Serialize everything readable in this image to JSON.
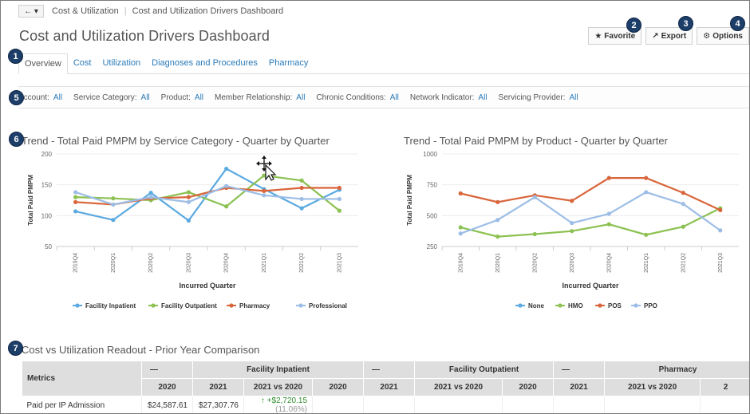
{
  "breadcrumb": {
    "nav": "← ▾",
    "items": [
      "Cost & Utilization",
      "Cost and Utilization Drivers Dashboard"
    ]
  },
  "title": "Cost and Utilization Drivers Dashboard",
  "actions": [
    {
      "label": "Favorite",
      "icon": "star-icon",
      "glyph": "★"
    },
    {
      "label": "Export",
      "icon": "export-icon",
      "glyph": "↗"
    },
    {
      "label": "Options",
      "icon": "gear-icon",
      "glyph": "⚙"
    }
  ],
  "badges": [
    "1",
    "2",
    "3",
    "4",
    "5",
    "6",
    "7"
  ],
  "tabs": [
    "Overview",
    "Cost",
    "Utilization",
    "Diagnoses and Procedures",
    "Pharmacy"
  ],
  "filters": [
    {
      "label": "Account:",
      "value": "All"
    },
    {
      "label": "Service Category:",
      "value": "All"
    },
    {
      "label": "Product:",
      "value": "All"
    },
    {
      "label": "Member Relationship:",
      "value": "All"
    },
    {
      "label": "Chronic Conditions:",
      "value": "All"
    },
    {
      "label": "Network Indicator:",
      "value": "All"
    },
    {
      "label": "Servicing Provider:",
      "value": "All"
    }
  ],
  "chart_data": [
    {
      "type": "line",
      "title": "Trend - Total Paid PMPM by Service Category - Quarter by Quarter",
      "xlabel": "Incurred Quarter",
      "ylabel": "Total Paid PMPM",
      "categories": [
        "2019Q4",
        "2020Q1",
        "2020Q2",
        "2020Q3",
        "2020Q4",
        "2021Q1",
        "2021Q2",
        "2021Q3"
      ],
      "ylim": [
        50,
        200
      ],
      "yticks": [
        50,
        100,
        150,
        200
      ],
      "grid": true,
      "legend": "bottom",
      "series": [
        {
          "name": "Facility Inpatient",
          "color": "#5aa9e0",
          "values": [
            107,
            93,
            137,
            92,
            176,
            143,
            112,
            142
          ]
        },
        {
          "name": "Facility Outpatient",
          "color": "#8cc152",
          "values": [
            130,
            128,
            125,
            138,
            115,
            165,
            157,
            108
          ]
        },
        {
          "name": "Pharmacy",
          "color": "#d9653a",
          "values": [
            122,
            118,
            128,
            130,
            145,
            140,
            145,
            145
          ]
        },
        {
          "name": "Professional",
          "color": "#9cbde6",
          "values": [
            138,
            118,
            130,
            122,
            148,
            133,
            127,
            127
          ]
        }
      ]
    },
    {
      "type": "line",
      "title": "Trend - Total Paid PMPM by Product - Quarter by Quarter",
      "xlabel": "Incurred Quarter",
      "ylabel": "Total Paid PMPM",
      "categories": [
        "2019Q4",
        "2020Q1",
        "2020Q2",
        "2020Q3",
        "2020Q4",
        "2021Q1",
        "2021Q2",
        "2021Q3"
      ],
      "ylim": [
        250,
        1000
      ],
      "yticks": [
        250,
        500,
        750,
        1000
      ],
      "grid": true,
      "legend": "bottom",
      "series": [
        {
          "name": "None",
          "color": "#5aa9e0",
          "values": [
            null,
            null,
            null,
            null,
            null,
            null,
            null,
            null
          ]
        },
        {
          "name": "HMO",
          "color": "#8cc152",
          "values": [
            405,
            330,
            350,
            375,
            430,
            345,
            410,
            560
          ]
        },
        {
          "name": "POS",
          "color": "#d9653a",
          "values": [
            680,
            610,
            665,
            620,
            805,
            805,
            685,
            545
          ]
        },
        {
          "name": "PPO",
          "color": "#9cbde6",
          "values": [
            355,
            465,
            650,
            440,
            515,
            690,
            595,
            380
          ]
        }
      ]
    }
  ],
  "table": {
    "title": "Cost vs Utilization Readout - Prior Year Comparison",
    "metrics_header": "Metrics",
    "groups": [
      {
        "dash": "—",
        "name": "Facility Inpatient"
      },
      {
        "dash": "—",
        "name": "Facility Outpatient"
      },
      {
        "dash": "—",
        "name": "Pharmacy"
      },
      {
        "dash": "—",
        "name": ""
      }
    ],
    "subheaders": [
      "2020",
      "2021",
      "2021 vs 2020"
    ],
    "last_sub": "2",
    "rows": [
      {
        "metric": "Paid per IP Admission",
        "v2020": "$24,587.61",
        "v2021": "$27,307.76",
        "arrow": "↑",
        "delta": "+$2,720.15",
        "pct": "(11.06%)"
      }
    ]
  }
}
